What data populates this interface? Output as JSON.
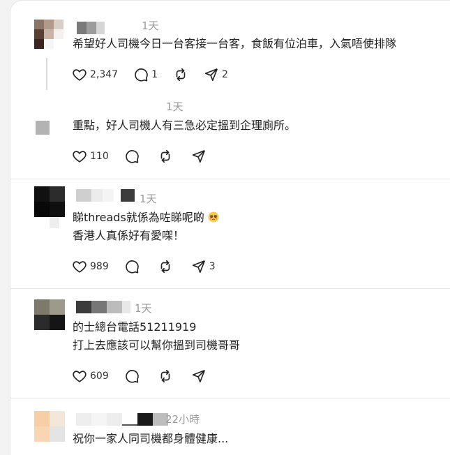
{
  "posts": [
    {
      "time": "1天",
      "lines": [
        "希望好人司機今日一台客接一台客，食飯有位泊車，入氣唔使排隊"
      ],
      "likes": "2,347",
      "replies": "1",
      "shares": "2"
    },
    {
      "time": "1天",
      "lines": [
        "重點，好人司機人有三急必定搵到企理廁所。"
      ],
      "likes": "110",
      "replies": "",
      "shares": ""
    },
    {
      "time": "1天",
      "lines": [
        "睇threads就係為咗睇呢啲",
        "香港人真係好有愛㗎！"
      ],
      "likes": "989",
      "replies": "",
      "shares": "3"
    },
    {
      "time": "1天",
      "lines": [
        "的士總台電話51211919",
        "打上去應該可以幫你搵到司機哥哥"
      ],
      "likes": "609",
      "replies": "",
      "shares": ""
    },
    {
      "time": "22小時",
      "lines": [
        "祝你一家人同司機都身體健康..."
      ],
      "likes": "",
      "replies": "",
      "shares": ""
    }
  ],
  "icons": {
    "like": "heart-icon",
    "reply": "comment-icon",
    "repost": "repost-icon",
    "share": "send-icon",
    "emoji": "pleading-face-emoji"
  },
  "colors": {
    "text": "#222222",
    "muted": "#9a9a9a",
    "divider": "#e5e5e5"
  }
}
